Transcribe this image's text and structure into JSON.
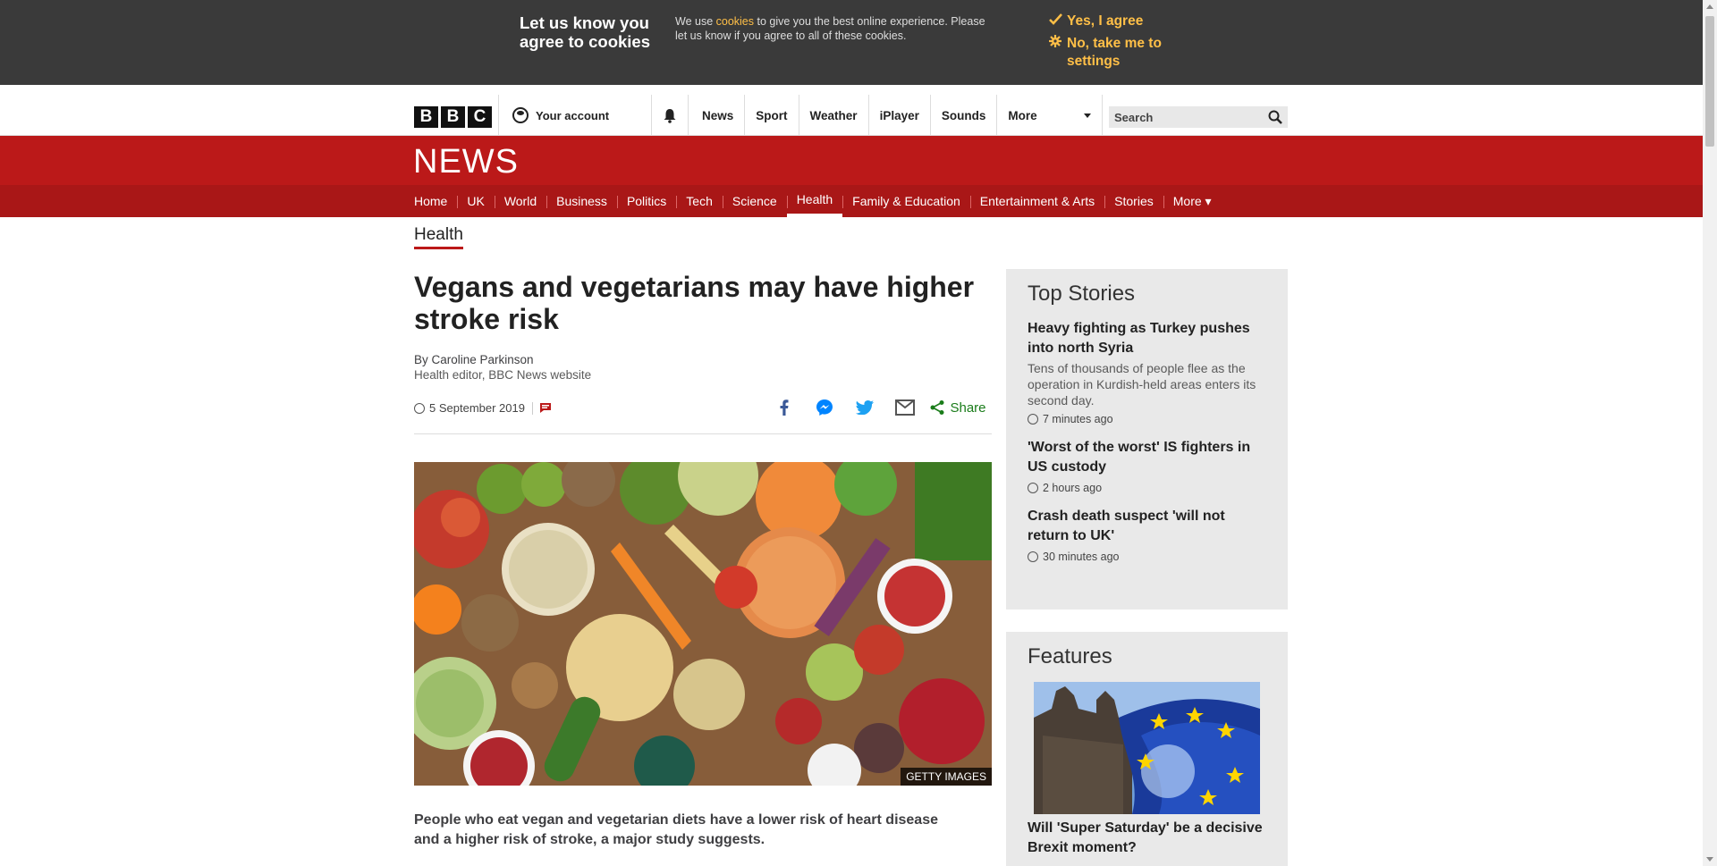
{
  "cookie_banner": {
    "title": "Let us know you agree to cookies",
    "text_before": "We use ",
    "cookies_link": "cookies",
    "text_after": " to give you the best online experience. Please let us know if you agree to all of these cookies.",
    "agree_label": "Yes, I agree",
    "settings_label": "No, take me to settings"
  },
  "masthead": {
    "logo_letters": [
      "B",
      "B",
      "C"
    ],
    "account_label": "Your account",
    "nav": [
      "News",
      "Sport",
      "Weather",
      "iPlayer",
      "Sounds"
    ],
    "more_label": "More",
    "search_placeholder": "Search"
  },
  "news": {
    "logo": "NEWS",
    "nav": [
      "Home",
      "UK",
      "World",
      "Business",
      "Politics",
      "Tech",
      "Science",
      "Health",
      "Family & Education",
      "Entertainment & Arts",
      "Stories"
    ],
    "active": "Health",
    "more_label": "More ▾",
    "section_label": "Health"
  },
  "article": {
    "headline": "Vegans and vegetarians may have higher stroke risk",
    "byline": "By Caroline Parkinson",
    "role": "Health editor, BBC News website",
    "date": "5 September 2019",
    "share_label": "Share",
    "image_credit": "GETTY IMAGES",
    "lede": "People who eat vegan and vegetarian diets have a lower risk of heart disease and a higher risk of stroke, a major study suggests."
  },
  "top_stories": {
    "heading": "Top Stories",
    "items": [
      {
        "title": "Heavy fighting as Turkey pushes into north Syria",
        "summary": "Tens of thousands of people flee as the operation in Kurdish-held areas enters its second day.",
        "ago": "7 minutes ago"
      },
      {
        "title": "'Worst of the worst' IS fighters in US custody",
        "summary": "",
        "ago": "2 hours ago"
      },
      {
        "title": "Crash death suspect 'will not return to UK'",
        "summary": "",
        "ago": "30 minutes ago"
      }
    ]
  },
  "features": {
    "heading": "Features",
    "items": [
      {
        "title": "Will 'Super Saturday' be a decisive Brexit moment?"
      }
    ]
  },
  "colors": {
    "bbc_red": "#bb1919",
    "cookie_bg": "#3a3a3a",
    "cookie_accent": "#ffbf47",
    "share_green": "#1a7c1a"
  }
}
